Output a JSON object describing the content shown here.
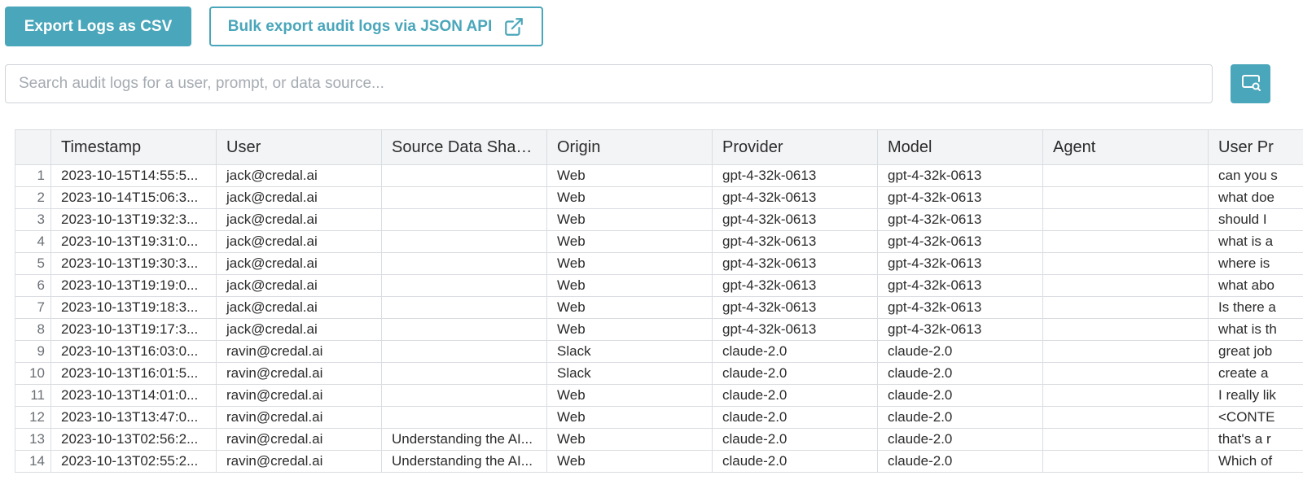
{
  "toolbar": {
    "export_csv_label": "Export Logs as CSV",
    "bulk_export_label": "Bulk export audit logs via JSON API",
    "bulk_export_icon": "external-link-icon"
  },
  "search": {
    "placeholder": "Search audit logs for a user, prompt, or data source...",
    "value": "",
    "button_icon": "search-icon"
  },
  "colors": {
    "accent": "#4aa6ba",
    "header_bg": "#f3f4f6",
    "border": "#d9dde1"
  },
  "table": {
    "columns": [
      "",
      "Timestamp",
      "User",
      "Source Data Shared",
      "Origin",
      "Provider",
      "Model",
      "Agent",
      "User Pr"
    ],
    "rows": [
      {
        "index": "1",
        "timestamp": "2023-10-15T14:55:5...",
        "user": "jack@credal.ai",
        "source": "",
        "origin": "Web",
        "provider": "gpt-4-32k-0613",
        "model": "gpt-4-32k-0613",
        "agent": "",
        "prompt": "can you s"
      },
      {
        "index": "2",
        "timestamp": "2023-10-14T15:06:3...",
        "user": "jack@credal.ai",
        "source": "",
        "origin": "Web",
        "provider": "gpt-4-32k-0613",
        "model": "gpt-4-32k-0613",
        "agent": "",
        "prompt": "what doe"
      },
      {
        "index": "3",
        "timestamp": "2023-10-13T19:32:3...",
        "user": "jack@credal.ai",
        "source": "",
        "origin": "Web",
        "provider": "gpt-4-32k-0613",
        "model": "gpt-4-32k-0613",
        "agent": "",
        "prompt": "should I"
      },
      {
        "index": "4",
        "timestamp": "2023-10-13T19:31:0...",
        "user": "jack@credal.ai",
        "source": "",
        "origin": "Web",
        "provider": "gpt-4-32k-0613",
        "model": "gpt-4-32k-0613",
        "agent": "",
        "prompt": "what is a"
      },
      {
        "index": "5",
        "timestamp": "2023-10-13T19:30:3...",
        "user": "jack@credal.ai",
        "source": "",
        "origin": "Web",
        "provider": "gpt-4-32k-0613",
        "model": "gpt-4-32k-0613",
        "agent": "",
        "prompt": "where is"
      },
      {
        "index": "6",
        "timestamp": "2023-10-13T19:19:0...",
        "user": "jack@credal.ai",
        "source": "",
        "origin": "Web",
        "provider": "gpt-4-32k-0613",
        "model": "gpt-4-32k-0613",
        "agent": "",
        "prompt": "what abo"
      },
      {
        "index": "7",
        "timestamp": "2023-10-13T19:18:3...",
        "user": "jack@credal.ai",
        "source": "",
        "origin": "Web",
        "provider": "gpt-4-32k-0613",
        "model": "gpt-4-32k-0613",
        "agent": "",
        "prompt": "Is there a"
      },
      {
        "index": "8",
        "timestamp": "2023-10-13T19:17:3...",
        "user": "jack@credal.ai",
        "source": "",
        "origin": "Web",
        "provider": "gpt-4-32k-0613",
        "model": "gpt-4-32k-0613",
        "agent": "",
        "prompt": "what is th"
      },
      {
        "index": "9",
        "timestamp": "2023-10-13T16:03:0...",
        "user": "ravin@credal.ai",
        "source": "",
        "origin": "Slack",
        "provider": "claude-2.0",
        "model": "claude-2.0",
        "agent": "",
        "prompt": "great job"
      },
      {
        "index": "10",
        "timestamp": "2023-10-13T16:01:5...",
        "user": "ravin@credal.ai",
        "source": "",
        "origin": "Slack",
        "provider": "claude-2.0",
        "model": "claude-2.0",
        "agent": "",
        "prompt": "create a"
      },
      {
        "index": "11",
        "timestamp": "2023-10-13T14:01:0...",
        "user": "ravin@credal.ai",
        "source": "",
        "origin": "Web",
        "provider": "claude-2.0",
        "model": "claude-2.0",
        "agent": "",
        "prompt": "I really lik"
      },
      {
        "index": "12",
        "timestamp": "2023-10-13T13:47:0...",
        "user": "ravin@credal.ai",
        "source": "",
        "origin": "Web",
        "provider": "claude-2.0",
        "model": "claude-2.0",
        "agent": "",
        "prompt": "<CONTE"
      },
      {
        "index": "13",
        "timestamp": "2023-10-13T02:56:2...",
        "user": "ravin@credal.ai",
        "source": "Understanding the AI...",
        "origin": "Web",
        "provider": "claude-2.0",
        "model": "claude-2.0",
        "agent": "",
        "prompt": "that's a r"
      },
      {
        "index": "14",
        "timestamp": "2023-10-13T02:55:2...",
        "user": "ravin@credal.ai",
        "source": "Understanding the AI...",
        "origin": "Web",
        "provider": "claude-2.0",
        "model": "claude-2.0",
        "agent": "",
        "prompt": "Which of"
      }
    ]
  }
}
